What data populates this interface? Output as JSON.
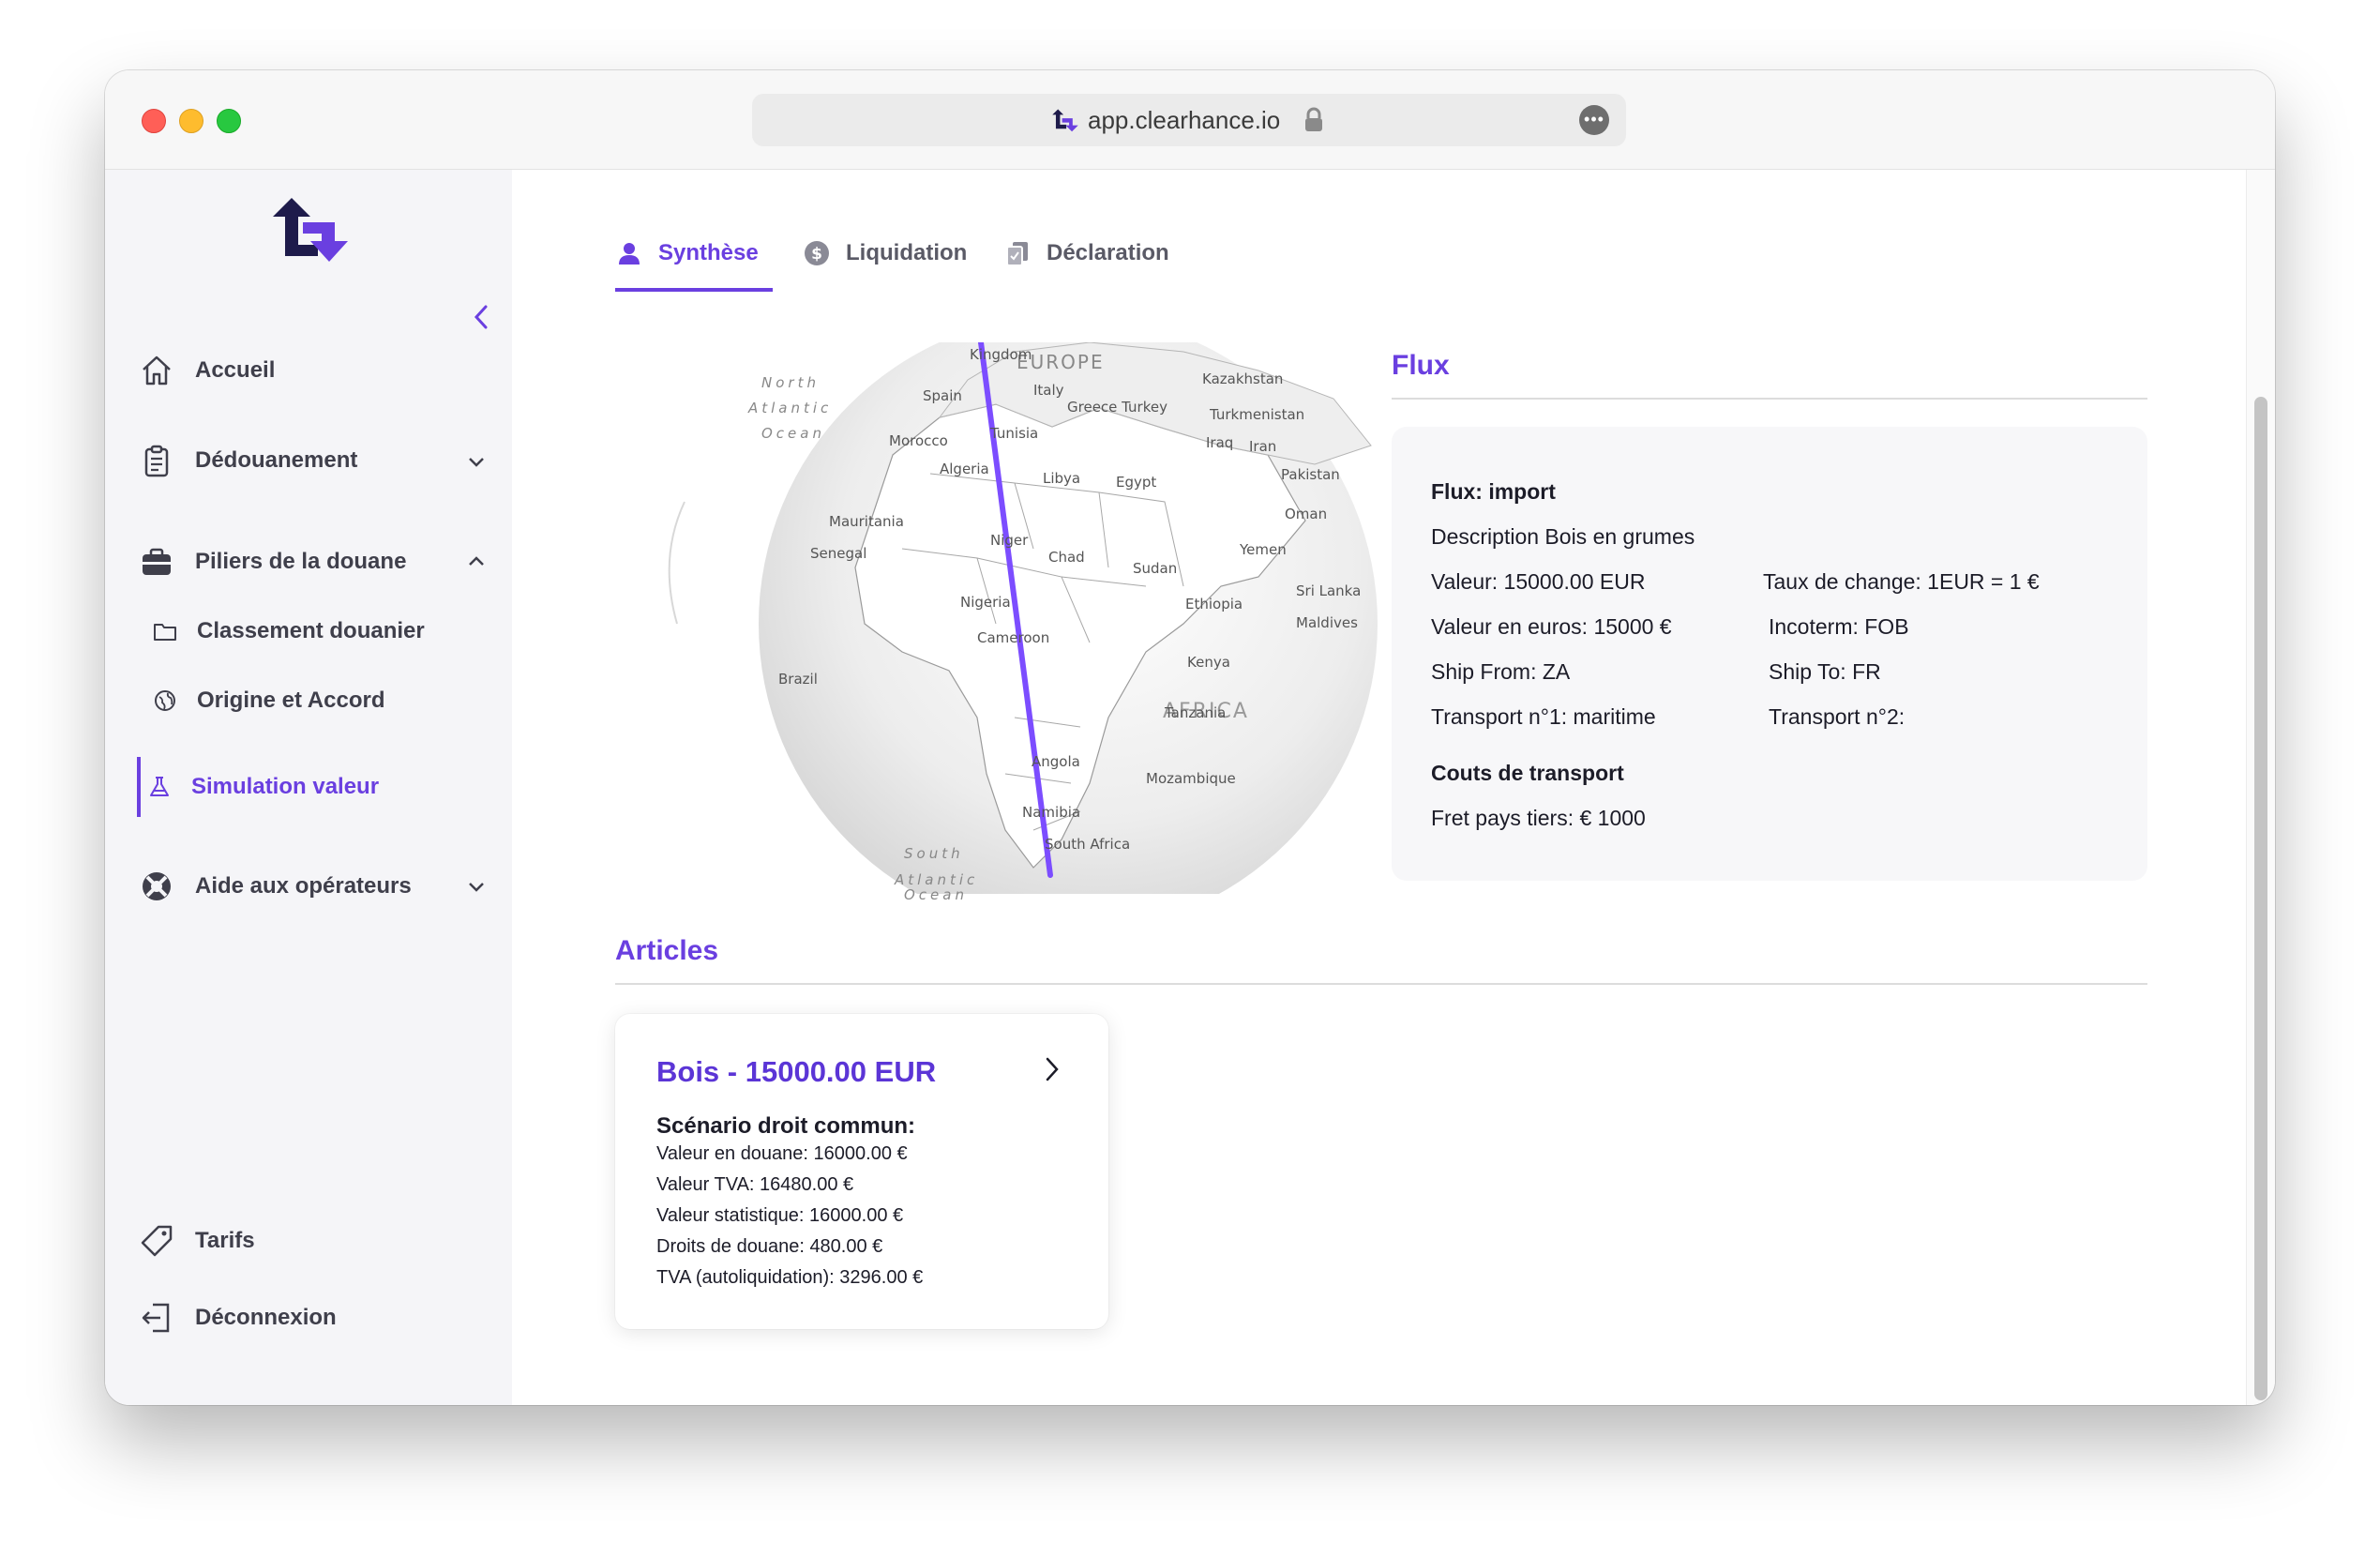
{
  "browser": {
    "url": "app.clearhance.io"
  },
  "sidebar": {
    "items": [
      {
        "label": "Accueil",
        "icon": "home-icon"
      },
      {
        "label": "Dédouanement",
        "icon": "clipboard-icon"
      },
      {
        "label": "Piliers de la douane",
        "icon": "briefcase-icon"
      },
      {
        "label": "Aide aux opérateurs",
        "icon": "lifebuoy-icon"
      }
    ],
    "subitems": [
      {
        "label": "Classement douanier",
        "icon": "folder-icon"
      },
      {
        "label": "Origine et Accord",
        "icon": "globe-icon"
      },
      {
        "label": "Simulation valeur",
        "icon": "flask-icon"
      }
    ],
    "bottom": [
      {
        "label": "Tarifs",
        "icon": "tag-icon"
      },
      {
        "label": "Déconnexion",
        "icon": "logout-icon"
      }
    ]
  },
  "tabs": [
    {
      "label": "Synthèse",
      "icon": "user-icon"
    },
    {
      "label": "Liquidation",
      "icon": "dollar-icon"
    },
    {
      "label": "Déclaration",
      "icon": "document-icon"
    }
  ],
  "map": {
    "labels": {
      "north_atlantic_1": "North",
      "north_atlantic_2": "Atlantic",
      "north_atlantic_3": "Ocean",
      "south_atlantic_1": "South",
      "south_atlantic_2": "Atlantic",
      "south_atlantic_3": "Ocean",
      "europe": "EUROPE",
      "africa": "AFRICA",
      "kingdom": "Kingdom",
      "spain": "Spain",
      "italy": "Italy",
      "greece_turkey": "Greece Turkey",
      "kazakhstan": "Kazakhstan",
      "turkmenistan": "Turkmenistan",
      "iraq": "Iraq",
      "iran": "Iran",
      "morocco": "Morocco",
      "tunisia": "Tunisia",
      "algeria": "Algeria",
      "libya": "Libya",
      "egypt": "Egypt",
      "pakistan": "Pakistan",
      "oman": "Oman",
      "mauritania": "Mauritania",
      "senegal": "Senegal",
      "niger": "Niger",
      "chad": "Chad",
      "sudan": "Sudan",
      "yemen": "Yemen",
      "sri_lanka": "Sri Lanka",
      "maldives": "Maldives",
      "nigeria": "Nigeria",
      "ethiopia": "Ethiopia",
      "cameroon": "Cameroon",
      "brazil": "Brazil",
      "kenya": "Kenya",
      "tanzania": "Tanzania",
      "angola": "Angola",
      "mozambique": "Mozambique",
      "namibia": "Namibia",
      "south_africa": "South Africa"
    }
  },
  "flux": {
    "title": "Flux",
    "type": "Flux: import",
    "description": "Description Bois en grumes",
    "valeur": "Valeur: 15000.00 EUR",
    "taux": "Taux de change: 1EUR = 1 €",
    "valeur_euros": "Valeur en euros: 15000 €",
    "incoterm": "Incoterm: FOB",
    "ship_from": "Ship From: ZA",
    "ship_to": "Ship To: FR",
    "transport1": "Transport n°1: maritime",
    "transport2": "Transport n°2:",
    "couts_title": "Couts de transport",
    "fret": "Fret pays tiers: € 1000"
  },
  "articles": {
    "title": "Articles",
    "items": [
      {
        "title": "Bois - 15000.00 EUR",
        "scenario": "Scénario droit commun:",
        "lines": [
          "Valeur en douane: 16000.00 €",
          "Valeur TVA: 16480.00 €",
          "Valeur statistique: 16000.00 €",
          "Droits de douane: 480.00 €",
          "TVA (autoliquidation): 3296.00 €"
        ]
      }
    ]
  },
  "colors": {
    "accent": "#6a3fe0",
    "brand_dark": "#1e1b4b",
    "route": "#7c4dff"
  }
}
